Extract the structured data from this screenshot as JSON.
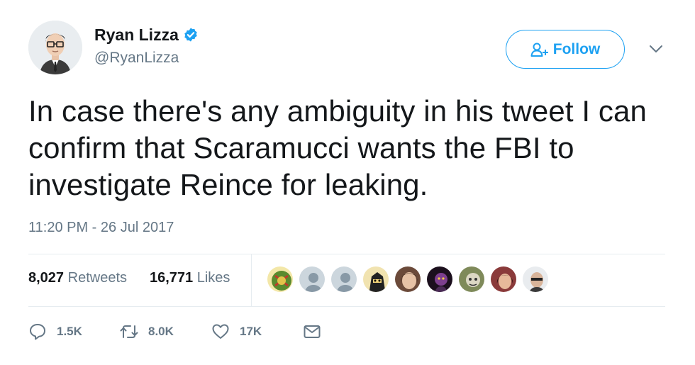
{
  "user": {
    "display_name": "Ryan Lizza",
    "handle": "@RyanLizza",
    "verified": true,
    "avatar_icon": "cartoon-portrait-avatar"
  },
  "follow_button": {
    "label": "Follow",
    "icon": "add-user-icon"
  },
  "menu_caret": {
    "icon": "chevron-down-icon"
  },
  "tweet": {
    "text": "In case there's any ambiguity in his tweet I can confirm that Scaramucci wants the FBI to investigate Reince for leaking.",
    "timestamp": "11:20 PM - 26 Jul 2017"
  },
  "stats": {
    "retweets_count": "8,027",
    "retweets_label": "Retweets",
    "likes_count": "16,771",
    "likes_label": "Likes"
  },
  "likers": [
    {
      "icon": "liker-avatar-green-emblem",
      "color": "#5a8a2e"
    },
    {
      "icon": "liker-avatar-default",
      "color": "#aab8c2"
    },
    {
      "icon": "liker-avatar-default",
      "color": "#aab8c2"
    },
    {
      "icon": "liker-avatar-cartoon",
      "color": "#2b2b2b"
    },
    {
      "icon": "liker-avatar-photo",
      "color": "#6b4a3a"
    },
    {
      "icon": "liker-avatar-dark",
      "color": "#3a1f3d"
    },
    {
      "icon": "liker-avatar-photo",
      "color": "#7f8a5a"
    },
    {
      "icon": "liker-avatar-photo",
      "color": "#8a3a3a"
    },
    {
      "icon": "liker-avatar-photo",
      "color": "#5a4a3e"
    }
  ],
  "actions": {
    "reply_count": "1.5K",
    "retweet_count": "8.0K",
    "like_count": "17K",
    "icons": [
      "reply-icon",
      "retweet-icon",
      "heart-icon",
      "message-icon"
    ]
  },
  "colors": {
    "accent": "#1da1f2",
    "text": "#14171a",
    "secondary": "#657786",
    "divider": "#e6ecf0"
  }
}
